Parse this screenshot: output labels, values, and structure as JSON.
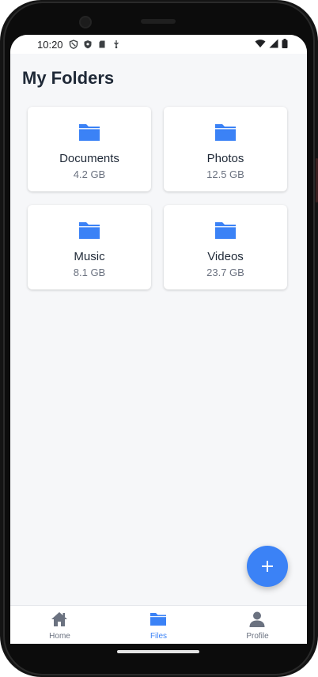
{
  "status_bar": {
    "time": "10:20",
    "left_icons": [
      "vpn-shield-icon",
      "shield-icon",
      "sd-card-icon",
      "usb-debug-icon"
    ],
    "right_icons": [
      "wifi-icon",
      "signal-icon",
      "battery-icon"
    ]
  },
  "header": {
    "title": "My Folders"
  },
  "folders": [
    {
      "name": "Documents",
      "size": "4.2 GB",
      "icon": "folder-icon"
    },
    {
      "name": "Photos",
      "size": "12.5 GB",
      "icon": "folder-icon"
    },
    {
      "name": "Music",
      "size": "8.1 GB",
      "icon": "folder-icon"
    },
    {
      "name": "Videos",
      "size": "23.7 GB",
      "icon": "folder-icon"
    }
  ],
  "fab": {
    "icon": "plus-icon"
  },
  "bottom_nav": {
    "items": [
      {
        "label": "Home",
        "icon": "home-icon",
        "active": false
      },
      {
        "label": "Files",
        "icon": "folder-icon",
        "active": true
      },
      {
        "label": "Profile",
        "icon": "person-icon",
        "active": false
      }
    ]
  },
  "colors": {
    "accent": "#3b82f6",
    "title": "#1f2937",
    "muted": "#6b7280",
    "background": "#f6f7f9"
  }
}
